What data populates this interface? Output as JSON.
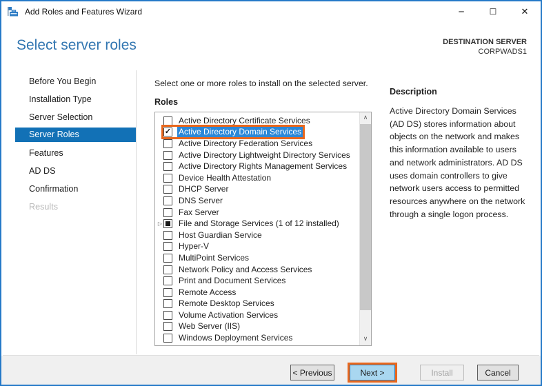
{
  "window": {
    "title": "Add Roles and Features Wizard"
  },
  "icons": {
    "minimize": "─",
    "maximize": "☐",
    "close": "✕",
    "expander": "▷",
    "check": "✓",
    "scroll_up": "∧",
    "scroll_down": "∨"
  },
  "header": {
    "title": "Select server roles",
    "destination_label": "DESTINATION SERVER",
    "destination_server": "CORPWADS1"
  },
  "sidebar": {
    "items": [
      {
        "label": "Before You Begin",
        "state": "normal"
      },
      {
        "label": "Installation Type",
        "state": "normal"
      },
      {
        "label": "Server Selection",
        "state": "normal"
      },
      {
        "label": "Server Roles",
        "state": "selected"
      },
      {
        "label": "Features",
        "state": "normal"
      },
      {
        "label": "AD DS",
        "state": "normal"
      },
      {
        "label": "Confirmation",
        "state": "normal"
      },
      {
        "label": "Results",
        "state": "disabled"
      }
    ]
  },
  "main": {
    "instruction": "Select one or more roles to install on the selected server.",
    "roles_caption": "Roles",
    "roles": [
      {
        "label": "Active Directory Certificate Services",
        "checked": false
      },
      {
        "label": "Active Directory Domain Services",
        "checked": true,
        "selected": true,
        "annotated": true
      },
      {
        "label": "Active Directory Federation Services",
        "checked": false
      },
      {
        "label": "Active Directory Lightweight Directory Services",
        "checked": false
      },
      {
        "label": "Active Directory Rights Management Services",
        "checked": false
      },
      {
        "label": "Device Health Attestation",
        "checked": false
      },
      {
        "label": "DHCP Server",
        "checked": false
      },
      {
        "label": "DNS Server",
        "checked": false
      },
      {
        "label": "Fax Server",
        "checked": false
      },
      {
        "label": "File and Storage Services (1 of 12 installed)",
        "checked": "partial",
        "expandable": true
      },
      {
        "label": "Host Guardian Service",
        "checked": false
      },
      {
        "label": "Hyper-V",
        "checked": false
      },
      {
        "label": "MultiPoint Services",
        "checked": false
      },
      {
        "label": "Network Policy and Access Services",
        "checked": false
      },
      {
        "label": "Print and Document Services",
        "checked": false
      },
      {
        "label": "Remote Access",
        "checked": false
      },
      {
        "label": "Remote Desktop Services",
        "checked": false
      },
      {
        "label": "Volume Activation Services",
        "checked": false
      },
      {
        "label": "Web Server (IIS)",
        "checked": false
      },
      {
        "label": "Windows Deployment Services",
        "checked": false
      }
    ]
  },
  "description": {
    "heading": "Description",
    "text": "Active Directory Domain Services (AD DS) stores information about objects on the network and makes this information available to users and network administrators. AD DS uses domain controllers to give network users access to permitted resources anywhere on the network through a single logon process."
  },
  "footer": {
    "buttons": [
      {
        "id": "previous",
        "label": "< Previous",
        "state": "normal"
      },
      {
        "id": "next",
        "label": "Next >",
        "state": "default",
        "annotated": true
      },
      {
        "id": "install",
        "label": "Install",
        "state": "disabled"
      },
      {
        "id": "cancel",
        "label": "Cancel",
        "state": "normal"
      }
    ]
  },
  "colors": {
    "window-border": "#2579c8",
    "heading-blue": "#3276b1",
    "accent-blue": "#1271b6",
    "selection-blue": "#2b88d8",
    "annotation-orange": "#e8671d",
    "next-blue": "#a9d7f0"
  }
}
